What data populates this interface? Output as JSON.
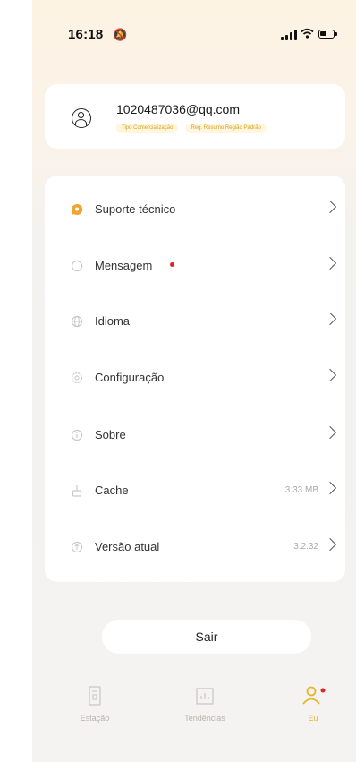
{
  "status_bar": {
    "time": "16:18"
  },
  "account": {
    "email": "1020487036@qq.com",
    "tags": [
      "Tipo Comercialização",
      "Reg. Resumo Região Padrão"
    ]
  },
  "menu": [
    {
      "label": "Suporte técnico",
      "icon": "support-icon"
    },
    {
      "label": "Mensagem",
      "icon": "message-icon",
      "badge": true
    },
    {
      "label": "Idioma",
      "icon": "globe-icon"
    },
    {
      "label": "Configuração",
      "icon": "settings-icon"
    },
    {
      "label": "Sobre",
      "icon": "info-icon"
    },
    {
      "label": "Cache",
      "icon": "broom-icon",
      "value": "3.33 MB"
    },
    {
      "label": "Versão atual",
      "icon": "version-icon",
      "value": "3.2.32"
    }
  ],
  "logout_label": "Sair",
  "tabs": [
    {
      "label": "Estação",
      "icon": "station-icon",
      "active": false
    },
    {
      "label": "Tendências",
      "icon": "trends-icon",
      "active": false
    },
    {
      "label": "Eu",
      "icon": "person-icon",
      "active": true
    }
  ],
  "colors": {
    "accent": "#e7b52a",
    "badge": "#e0242c",
    "support_icon": "#f0a531"
  }
}
